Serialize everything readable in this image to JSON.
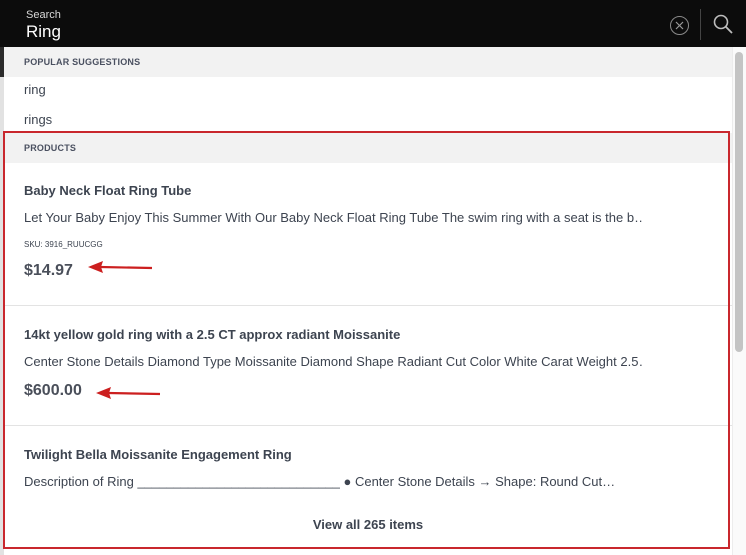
{
  "search": {
    "label": "Search",
    "value": "Ring"
  },
  "icons": {
    "clear": "close-circle-icon",
    "search": "magnifier-icon"
  },
  "suggestions": {
    "header": "POPULAR SUGGESTIONS",
    "items": [
      "ring",
      "rings"
    ]
  },
  "products": {
    "header": "PRODUCTS",
    "items": [
      {
        "title": "Baby Neck Float Ring Tube",
        "description": "Let Your Baby Enjoy This Summer With Our Baby Neck Float Ring Tube The swim ring with a seat is the b…",
        "sku": "SKU: 3916_RUUCGG",
        "price": "$14.97"
      },
      {
        "title": "14kt yellow gold ring with a 2.5 CT approx radiant Moissanite",
        "description": "Center Stone Details Diamond Type Moissanite Diamond Shape Radiant Cut Color White Carat Weight 2.5…",
        "price": "$600.00"
      },
      {
        "title": "Twilight Bella Moissanite Engagement Ring",
        "description": "Description of Ring ____________________________ ● Center Stone Details → Shape: Round Cut…"
      }
    ],
    "view_all": "View all 265 items"
  },
  "colors": {
    "search_bg": "#0c0c0c",
    "highlight": "#c9272d",
    "section_bg": "#f2f2f2",
    "text": "#3d4450"
  }
}
